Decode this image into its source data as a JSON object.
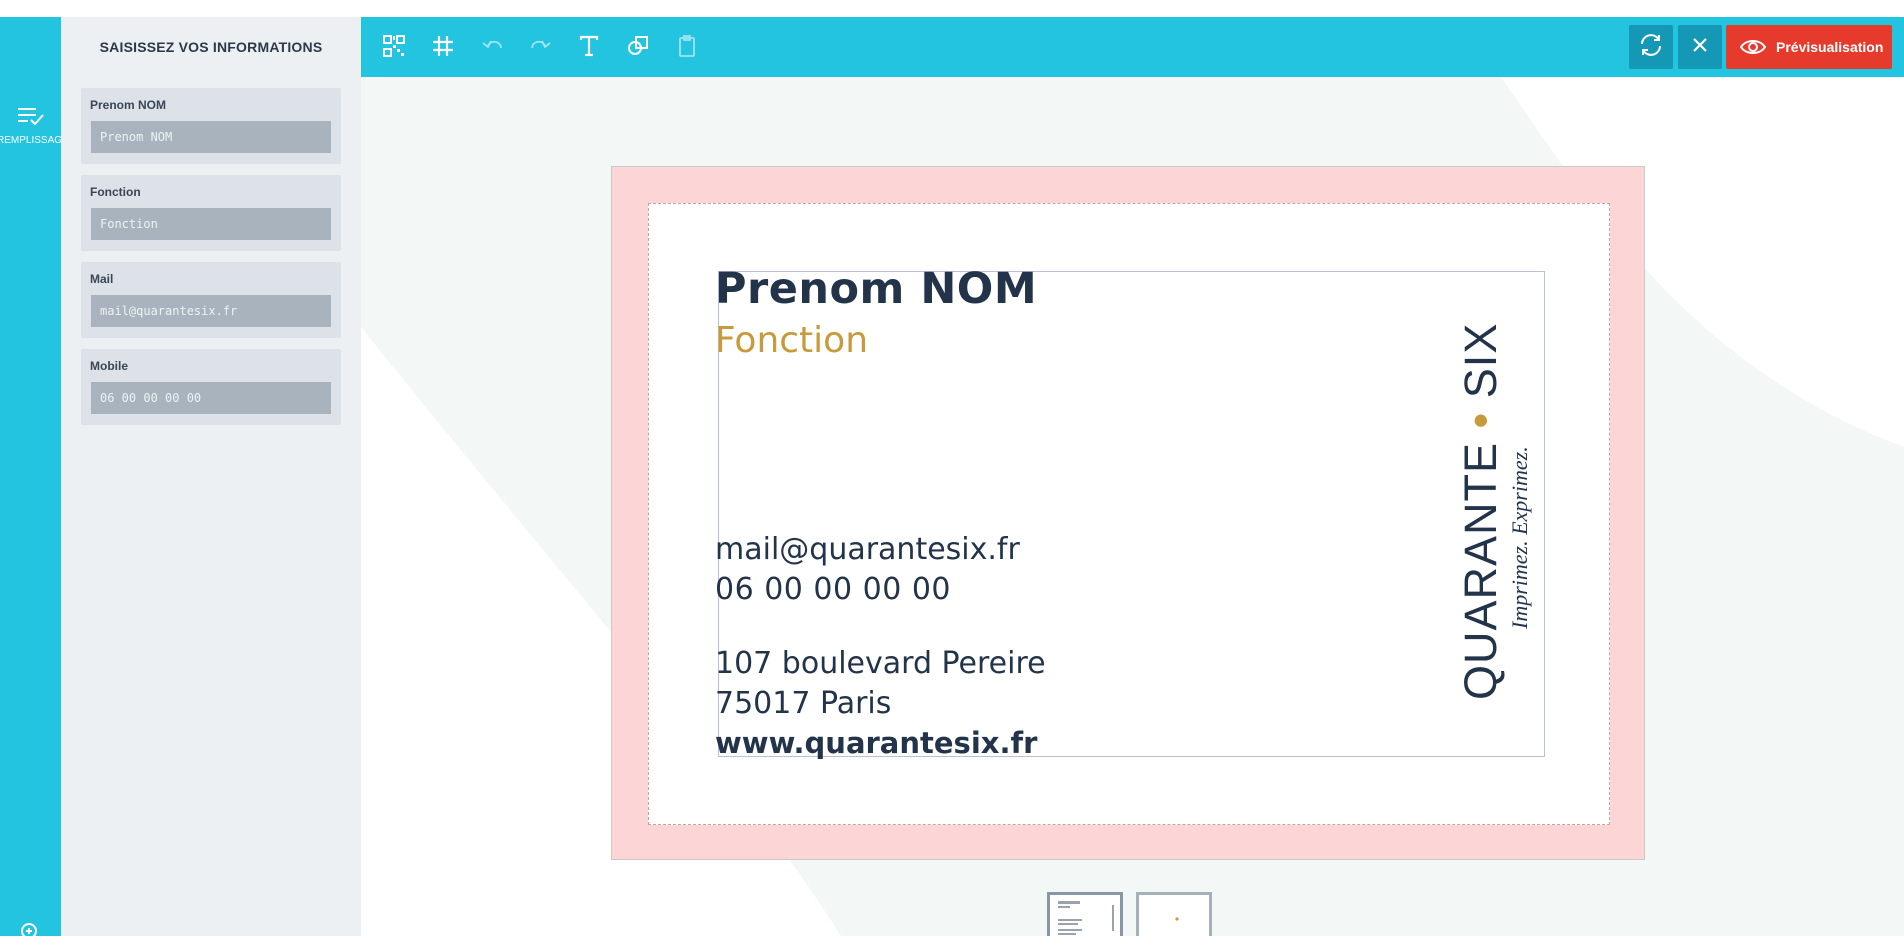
{
  "sidebar": {
    "rail_label": "REMPLISSAGE RAPIDE",
    "title": "SAISISSEZ VOS INFORMATIONS",
    "fields": [
      {
        "label": "Prenom NOM",
        "placeholder": "Prenom NOM"
      },
      {
        "label": "Fonction",
        "placeholder": "Fonction"
      },
      {
        "label": "Mail",
        "placeholder": "mail@quarantesix.fr"
      },
      {
        "label": "Mobile",
        "placeholder": "06 00 00 00 00"
      }
    ]
  },
  "toolbar": {
    "tools": [
      "qr-code-icon",
      "grid-icon",
      "undo-icon",
      "redo-icon",
      "text-icon",
      "shapes-icon",
      "clipboard-icon"
    ],
    "preview_label": "Prévisualisation"
  },
  "card": {
    "name": "Prenom NOM",
    "function": "Fonction",
    "mail": "mail@quarantesix.fr",
    "phone": "06 00 00 00 00",
    "address_line1": "107 boulevard Pereire",
    "address_line2": "75017 Paris",
    "website": "www.quarantesix.fr",
    "logo_brand_left": "QUARANTE",
    "logo_brand_right": "SIX",
    "logo_tagline": "Imprimez. Exprimez."
  },
  "colors": {
    "accent": "#22c4e0",
    "accent_dark": "#1597b6",
    "preview_button": "#e63a2c",
    "bleed": "#fcd6d6",
    "card_text": "#23344a",
    "gold": "#c99a3b"
  },
  "pages": {
    "count": 2,
    "active": 1
  }
}
